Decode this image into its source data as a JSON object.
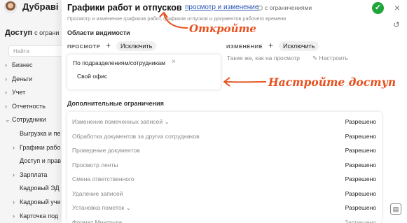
{
  "background_app": {
    "title": "Дубраві",
    "section_title": "Доступ",
    "section_subtitle": "с ограни",
    "search_placeholder": "Найти",
    "tree": [
      {
        "label": "Бизнес",
        "arrow": "›",
        "level": 0
      },
      {
        "label": "Деньги",
        "arrow": "›",
        "level": 0
      },
      {
        "label": "Учет",
        "arrow": "›",
        "level": 0
      },
      {
        "label": "Отчетность",
        "arrow": "›",
        "level": 0
      },
      {
        "label": "Сотрудники",
        "arrow": "⌄",
        "level": 0
      },
      {
        "label": "Выгрузка и пе",
        "arrow": "",
        "level": 1
      },
      {
        "label": "Графики рабо",
        "arrow": "›",
        "level": 1
      },
      {
        "label": "Доступ и прав",
        "arrow": "",
        "level": 1
      },
      {
        "label": "Зарплата",
        "arrow": "›",
        "level": 1
      },
      {
        "label": "Кадровый ЭД",
        "arrow": "",
        "level": 1
      },
      {
        "label": "Кадровый уче",
        "arrow": "›",
        "level": 1
      },
      {
        "label": "Карточка под",
        "arrow": "›",
        "level": 1
      }
    ]
  },
  "panel": {
    "title": "Графики работ и отпусков",
    "tab_link": "просмотр и изменение",
    "restrictions_toggle": "с ограничениями",
    "description": "Просмотр и изменение графиков работ, графиков отпусков и документов рабочего времени",
    "ok_icon": "check-icon",
    "close_icon": "close-icon",
    "scope_heading": "Области видимости",
    "view": {
      "label": "ПРОСМОТР",
      "plus": "+",
      "exclude_label": "Исключить",
      "items": [
        "По подразделениям/сотрудникам",
        "Свой офис"
      ]
    },
    "edit": {
      "label": "ИЗМЕНЕНИЕ",
      "plus": "+",
      "exclude_label": "Исключить",
      "same_as_view": "Такие же, как на просмотр",
      "configure_label": "Настроить"
    },
    "extra_heading": "Дополнительные ограничения",
    "restrictions": [
      {
        "name": "Изменение помеченных записей",
        "has_chevron": true,
        "value": "Разрешено"
      },
      {
        "name": "Обработка документов за других сотрудников",
        "has_chevron": false,
        "value": "Разрешено"
      },
      {
        "name": "Проведение документов",
        "has_chevron": false,
        "value": "Разрешено"
      },
      {
        "name": "Просмотр ленты",
        "has_chevron": false,
        "value": "Разрешено"
      },
      {
        "name": "Смена ответственного",
        "has_chevron": false,
        "value": "Разрешено"
      },
      {
        "name": "Удаление записей",
        "has_chevron": false,
        "value": "Разрешено"
      },
      {
        "name": "Установка пометок",
        "has_chevron": true,
        "value": "Разрешено"
      },
      {
        "name": "Формат Минтруда",
        "has_chevron": false,
        "value": "Запрещено"
      }
    ]
  },
  "annotations": {
    "open": "Откройте",
    "configure_access": "Настройте доступ",
    "color": "#e8501e"
  },
  "colors": {
    "accent_link": "#2b55b3",
    "ok_green": "#21a53a"
  }
}
